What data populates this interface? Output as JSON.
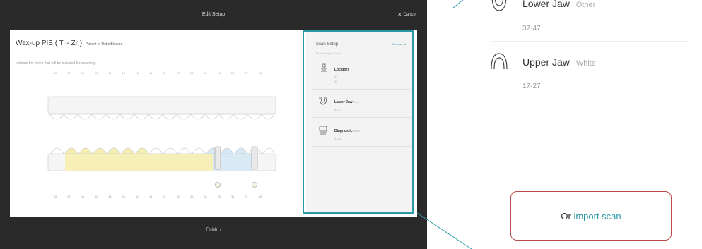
{
  "header": {
    "title": "Edit Setup",
    "cancel_label": "Cancel"
  },
  "footer": {
    "finish_label": "Finish"
  },
  "setup": {
    "name": "Wax-up PIB ( Ti - Zr )",
    "patient_label": "Patient of NobelBiocare",
    "instruction": "Indicate the items that will be included for scanning."
  },
  "upper_teeth": [
    "18",
    "17",
    "16",
    "15",
    "14",
    "13",
    "12",
    "11",
    "21",
    "22",
    "23",
    "24",
    "25",
    "26",
    "27",
    "28"
  ],
  "lower_teeth": [
    "48",
    "47",
    "46",
    "45",
    "44",
    "43",
    "42",
    "41",
    "31",
    "32",
    "33",
    "34",
    "35",
    "36",
    "37",
    "38"
  ],
  "scan_setup": {
    "title": "Scan Setup",
    "remove_all": "Remove all",
    "model_height_label": "Model height",
    "model_height_value": "60 mm",
    "items": [
      {
        "name": "Locators",
        "subtitle": "",
        "code1": "37",
        "code2": "33",
        "icon": "locator-icon"
      },
      {
        "name": "Lower Jaw",
        "subtitle": "Other",
        "code1": "37-47",
        "code2": "",
        "icon": "lower-jaw-icon"
      },
      {
        "name": "Diagnostic",
        "subtitle": "White",
        "code1": "37-33",
        "code2": "",
        "icon": "diagnostic-icon"
      }
    ]
  },
  "zoom": {
    "items": [
      {
        "name": "Lower Jaw",
        "subtitle": "Other",
        "code": "37-47",
        "icon": "lower-jaw-icon"
      },
      {
        "name": "Upper Jaw",
        "subtitle": "White",
        "code": "17-27",
        "icon": "upper-jaw-icon"
      }
    ],
    "import_prefix": "Or",
    "import_link": "import scan"
  },
  "colors": {
    "accent": "#2b98a6",
    "highlight_border": "#b94a4a",
    "wax_yellow": "#f6eeb0",
    "implant_blue": "#d7e9f5"
  }
}
